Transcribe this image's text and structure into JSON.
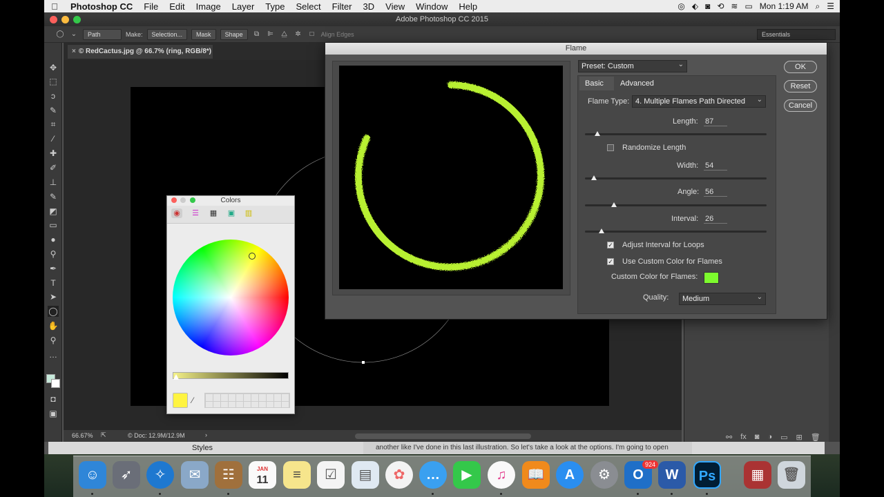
{
  "menubar": {
    "app": "Photoshop CC",
    "items": [
      "File",
      "Edit",
      "Image",
      "Layer",
      "Type",
      "Select",
      "Filter",
      "3D",
      "View",
      "Window",
      "Help"
    ],
    "clock": "Mon 1:19 AM"
  },
  "ps": {
    "window_title": "Adobe Photoshop CC 2015",
    "options": {
      "path_select": "Path",
      "make_label": "Make:",
      "selection_btn": "Selection...",
      "mask_btn": "Mask",
      "shape_btn": "Shape",
      "align_edges": "Align Edges"
    },
    "workspace": "Essentials",
    "doc_tab": "© RedCactus.jpg @ 66.7% (ring, RGB/8*) *",
    "status": {
      "zoom": "66.67%",
      "doc": "© Doc: 12.9M/12.9M"
    },
    "styles_label": "Styles"
  },
  "caption": "another like I've done in this last illustration. So let's take a look at the options. I'm going to open",
  "flame": {
    "title": "Flame",
    "preset": "Preset: Custom",
    "tabs": [
      "Basic",
      "Advanced"
    ],
    "flame_type_label": "Flame Type:",
    "flame_type_value": "4. Multiple Flames Path Directed",
    "length_label": "Length:",
    "length_value": "87",
    "length_level": 0.07,
    "randomize_label": "Randomize Length",
    "randomize_checked": false,
    "width_label": "Width:",
    "width_value": "54",
    "width_level": 0.05,
    "angle_label": "Angle:",
    "angle_value": "56",
    "angle_level": 0.16,
    "interval_label": "Interval:",
    "interval_value": "26",
    "interval_level": 0.09,
    "adjust_interval_label": "Adjust Interval for Loops",
    "adjust_interval_checked": true,
    "use_custom_color_label": "Use Custom Color for Flames",
    "use_custom_color_checked": true,
    "custom_color_label": "Custom Color for Flames:",
    "custom_color": "#7dfa2e",
    "quality_label": "Quality:",
    "quality_value": "Medium",
    "buttons": {
      "ok": "OK",
      "reset": "Reset",
      "cancel": "Cancel"
    },
    "flame_color": "#b8f030"
  },
  "colors_panel": {
    "title": "Colors",
    "current_color": "#fff441"
  },
  "dock": {
    "calendar_month": "JAN",
    "calendar_day": "11",
    "outlook_badge": "924"
  }
}
